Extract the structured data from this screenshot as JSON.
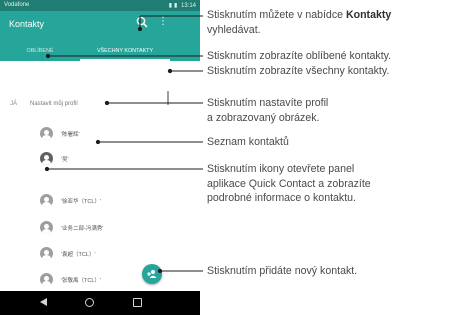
{
  "phone": {
    "status_bar": {
      "carrier": "Vodafone",
      "time": "13:14",
      "icons": [
        "wifi-icon",
        "signal-icon",
        "battery-icon"
      ]
    },
    "app_bar": {
      "title": "Kontakty",
      "search_icon": "search-icon",
      "more_icon": "more-vert-icon"
    },
    "tabs": [
      {
        "label": "OBLÍBENÉ",
        "selected": false
      },
      {
        "label": "VŠECHNY KONTAKTY",
        "selected": true
      }
    ],
    "me_section": {
      "label": "JÁ",
      "setup_text": "Nastavit můj profil"
    },
    "contacts": [
      {
        "name": "'陈署辉'"
      },
      {
        "name": "'吴'"
      },
      {
        "name": "'徐亚华（TCL）'"
      },
      {
        "name": "'业务二部-冯满秀'"
      },
      {
        "name": "'袁超（TCL）'"
      },
      {
        "name": "'张敬禹（TCL）'"
      }
    ],
    "fab_icon": "add-contact-icon",
    "nav_bar": {
      "icons": [
        "back-icon",
        "home-icon",
        "recent-apps-icon"
      ]
    },
    "colors": {
      "status_bar": "#1f7d74",
      "app_bar": "#26a69a",
      "accent": "#26a69a",
      "nav_bar": "#000000"
    }
  },
  "callouts": {
    "search": {
      "line1_prefix": "Stisknutím můžete v nabídce ",
      "line1_bold": "Kontakty",
      "line2": "vyhledávat."
    },
    "favorites": "Stisknutím zobrazíte oblíbené kontakty.",
    "all": "Stisknutím zobrazíte všechny kontakty.",
    "profile": {
      "line1": "Stisknutím nastavíte profil",
      "line2": "a zobrazovaný obrázek."
    },
    "list": "Seznam kontaktů",
    "quick_contact": {
      "line1": "Stisknutím ikony otevřete panel",
      "line2": "aplikace Quick Contact a zobrazíte",
      "line3": "podrobné informace o kontaktu."
    },
    "add": "Stisknutím přidáte nový kontakt."
  }
}
